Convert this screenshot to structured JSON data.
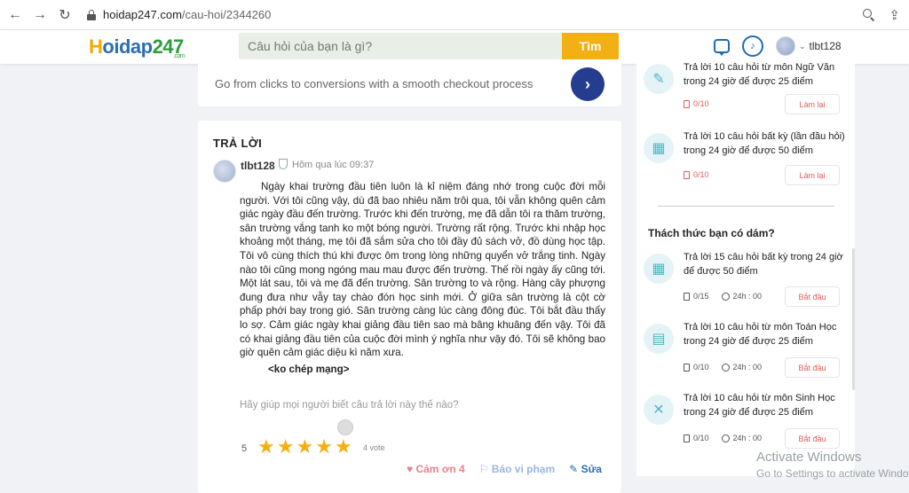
{
  "browser": {
    "url_domain": "hoidap247.com",
    "url_path": "/cau-hoi/2344260"
  },
  "header": {
    "logo_text": "Hoidap247",
    "logo_suffix": ".com",
    "search_placeholder": "Câu hỏi của bạn là gì?",
    "search_button": "Tìm",
    "username": "tlbt128"
  },
  "promo": {
    "text": "Go from clicks to conversions with a smooth checkout process",
    "arrow": "›"
  },
  "answer": {
    "heading": "TRẢ LỜI",
    "user": "tlbt128",
    "time": "Hôm qua lúc 09:37",
    "body": "Ngày khai trường đầu tiên luôn là kỉ niệm đáng nhớ trong cuộc đời mỗi người. Với tôi cũng vậy, dù đã bao nhiêu năm trôi qua, tôi vẫn không quên cảm giác ngày đầu đến trường. Trước khi đến trường, mẹ đã dẫn tôi ra thăm trường, sân trường vắng tanh ko một bóng người. Trường rất rộng. Trước khi nhập học khoảng một tháng, mẹ tôi đã sắm sửa cho tôi đầy đủ sách vở, đồ dùng học tập. Tôi vô cùng thích thú khi được ôm trong lòng những quyển vở trắng tinh. Ngày nào tôi cũng mong ngóng mau mau được đến trường. Thế rồi ngày ấy cũng tới. Một lát sau, tôi và mẹ đã đến trường. Sân trường to và rộng. Hàng cây phượng đung đưa như vẫy tay chào đón học sinh mới. Ở giữa sân trường là cột cờ phấp phới bay trong gió. Sân trường càng lúc càng đông đúc. Tôi bắt đầu thấy lo sợ. Cảm giác ngày khai giảng đầu tiên sao mà bâng khuâng đến vậy. Tôi đã có khai giảng đầu tiên của cuộc đời mình ý nghĩa như vậy đó. Tôi sẽ không bao giờ quên cảm giác diệu kì năm xưa.",
    "note": "<ko chép mạng>",
    "help_text": "Hãy giúp mọi người biết câu trả lời này thế nào?",
    "rating_value": "5",
    "stars_filled": 5,
    "stars_total": 5,
    "vote_count": "4 vote",
    "thanks_label": "Cảm ơn 4",
    "report_label": "Báo vi phạm",
    "edit_label": "Sửa"
  },
  "sidebar": {
    "tasks_top": [
      {
        "title": "Trả lời 10 câu hỏi  từ môn Ngữ Văn trong 24 giờ để được 25 điểm",
        "progress": "0/10",
        "button": "Làm lại",
        "icon": "pen-icon"
      },
      {
        "title": "Trả lời 10 câu hỏi  bất kỳ (lần đầu hỏi) trong 24 giờ để được 50 điểm",
        "progress": "0/10",
        "button": "Làm lại",
        "icon": "grid-icon"
      }
    ],
    "challenge_title": "Thách thức bạn có dám?",
    "challenges": [
      {
        "title": "Trả lời 15 câu hỏi  bất kỳ  trong 24 giờ để được 50 điểm",
        "progress": "0/15",
        "time": "24h : 00",
        "button": "Bắt đầu",
        "icon": "grid-icon"
      },
      {
        "title": "Trả lời 10 câu hỏi  từ môn Toán Học trong 24 giờ để được 25 điểm",
        "progress": "0/10",
        "time": "24h : 00",
        "button": "Bắt đầu",
        "icon": "calculator-icon"
      },
      {
        "title": "Trả lời 10 câu hỏi  từ môn Sinh Học trong 24 giờ để được 25 điểm",
        "progress": "0/10",
        "time": "24h : 00",
        "button": "Bắt đầu",
        "icon": "dna-icon"
      }
    ]
  },
  "watermark": {
    "title": "Activate Windows",
    "subtitle": "Go to Settings to activate Windows."
  },
  "colors": {
    "accent": "#f2b014",
    "brand_blue": "#2a6fb0",
    "danger": "#e25b5b",
    "promo_button": "#243d8f"
  }
}
